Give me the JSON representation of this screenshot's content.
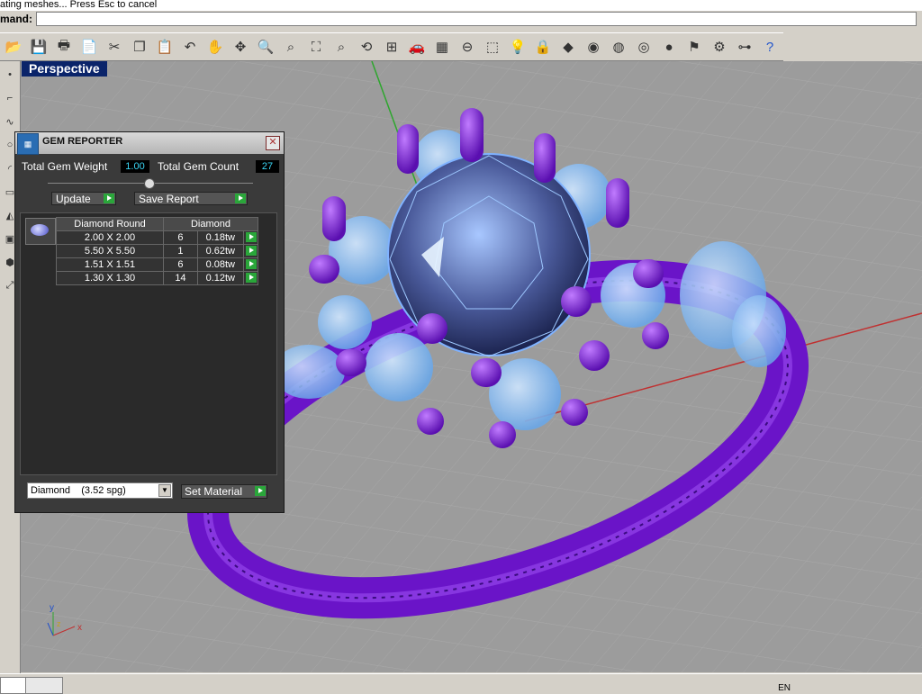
{
  "status_text": "ating meshes... Press Esc to cancel",
  "command": {
    "label": "mand:",
    "value": ""
  },
  "toolbar": {
    "icons": [
      "open-folder-icon",
      "save-icon",
      "print-icon",
      "import-icon",
      "cut-icon",
      "copy-icon",
      "paste-icon",
      "undo-icon",
      "pan-hand-icon",
      "rotate-view-icon",
      "zoom-icon",
      "zoom-window-icon",
      "zoom-extents-icon",
      "zoom-selected-icon",
      "undo-view-icon",
      "four-viewports-icon",
      "car-icon",
      "plane-grid-icon",
      "osnap-icon",
      "select-points-icon",
      "light-bulb-icon",
      "lock-icon",
      "object-properties-icon",
      "color-wheel-icon",
      "wireframe-sphere-icon",
      "mesh-sphere-icon",
      "render-sphere-icon",
      "flag-icon",
      "settings-gear-icon",
      "layer-icon",
      "help-icon"
    ]
  },
  "viewport": {
    "title": "Perspective",
    "axes": {
      "x": "x",
      "y": "y",
      "z": "z"
    }
  },
  "gem_reporter": {
    "title": "GEM REPORTER",
    "total_weight_label": "Total Gem Weight",
    "total_weight_value": "1.00",
    "total_count_label": "Total Gem Count",
    "total_count_value": "27",
    "update_label": "Update",
    "save_report_label": "Save Report",
    "table": {
      "headers": [
        "Diamond Round",
        "Diamond"
      ],
      "rows": [
        {
          "size": "2.00 X 2.00",
          "qty": "6",
          "weight": "0.18tw"
        },
        {
          "size": "5.50 X 5.50",
          "qty": "1",
          "weight": "0.62tw"
        },
        {
          "size": "1.51 X 1.51",
          "qty": "6",
          "weight": "0.08tw"
        },
        {
          "size": "1.30 X 1.30",
          "qty": "14",
          "weight": "0.12tw"
        }
      ]
    },
    "material_select": "Diamond    (3.52 spg)",
    "set_material_label": "Set Material"
  },
  "taskbar": {
    "language": "EN"
  },
  "colors": {
    "ring_purple": "#7b1fd8",
    "gem_blue": "#6cb4f5",
    "viewport_bg": "#9c9c9c",
    "title_blue": "#0a246a"
  }
}
